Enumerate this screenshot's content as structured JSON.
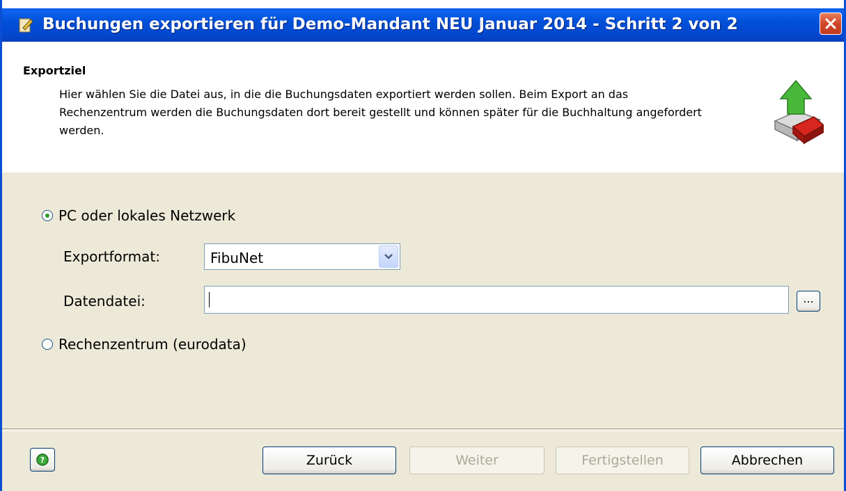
{
  "window": {
    "title": "Buchungen exportieren für Demo-Mandant NEU Januar 2014 - Schritt 2 von 2"
  },
  "header": {
    "title": "Exportziel",
    "description": "Hier wählen Sie die Datei aus, in die die Buchungsdaten exportiert werden sollen. Beim Export an das Rechenzentrum werden die Buchungsdaten dort bereit gestellt und können später für die Buchhaltung angefordert werden.",
    "icon": "export-book-icon"
  },
  "options": {
    "local": {
      "label": "PC oder lokales Netzwerk",
      "checked": true
    },
    "datacenter": {
      "label": "Rechenzentrum (eurodata)",
      "checked": false
    }
  },
  "form": {
    "format_label": "Exportformat:",
    "format_value": "FibuNet",
    "file_label": "Datendatei:",
    "file_value": "",
    "browse_label": "..."
  },
  "buttons": {
    "back": "Zurück",
    "next": "Weiter",
    "finish": "Fertigstellen",
    "cancel": "Abbrechen"
  },
  "colors": {
    "titlebar": "#0A4ED3",
    "dialog_bg": "#ECE9D8",
    "header_bg": "#FFFFFF"
  }
}
